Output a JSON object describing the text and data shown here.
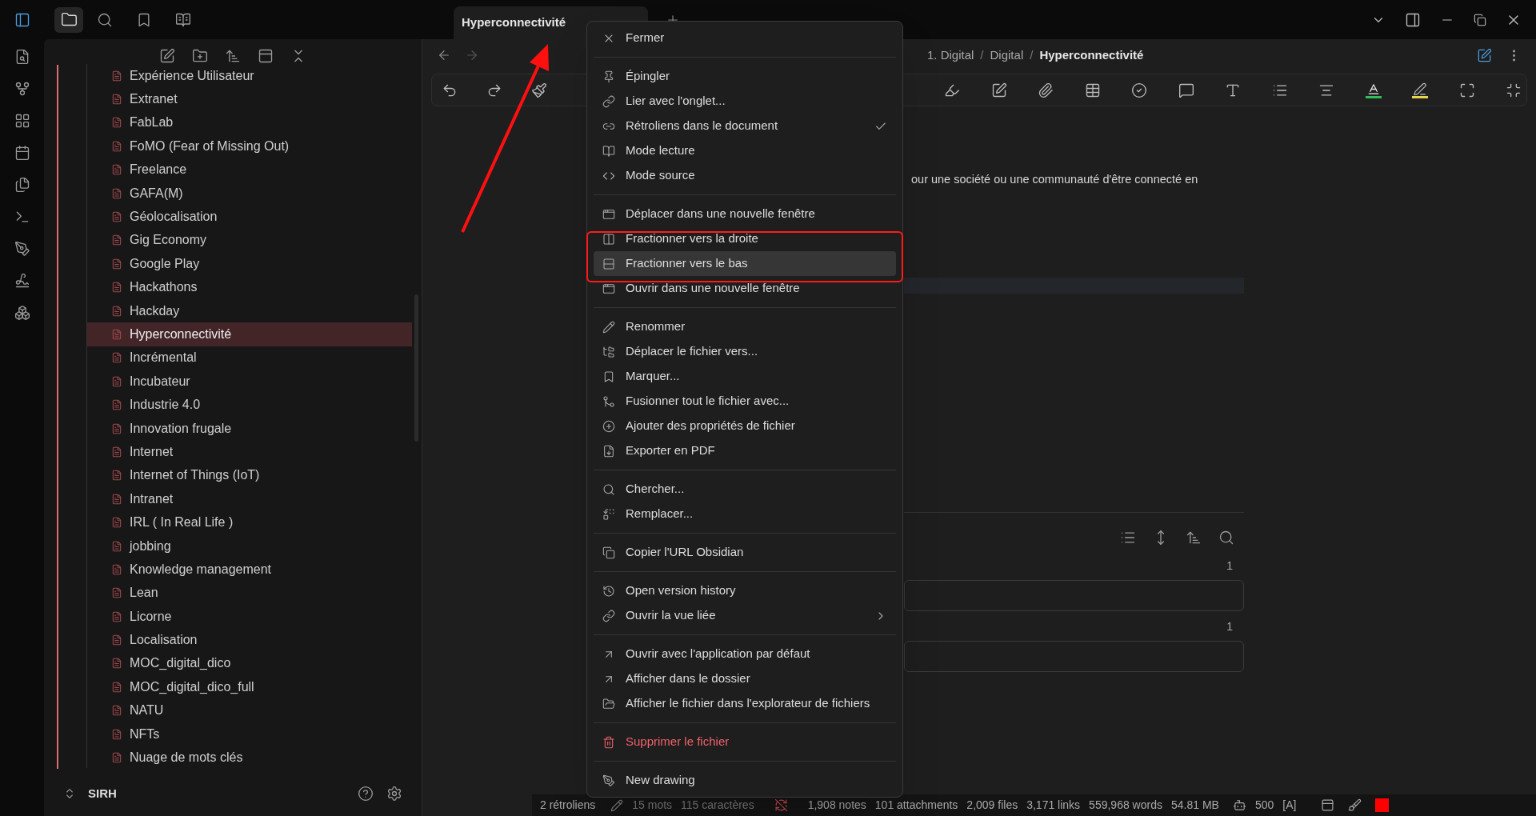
{
  "tab_bar": {
    "tab": {
      "title": "Hyperconnectivité"
    }
  },
  "sidebar": {
    "files": [
      {
        "name": "Expérience Utilisateur",
        "selected": false
      },
      {
        "name": "Extranet",
        "selected": false
      },
      {
        "name": "FabLab",
        "selected": false
      },
      {
        "name": "FoMO (Fear of Missing Out)",
        "selected": false
      },
      {
        "name": "Freelance",
        "selected": false
      },
      {
        "name": "GAFA(M)",
        "selected": false
      },
      {
        "name": "Géolocalisation",
        "selected": false
      },
      {
        "name": "Gig Economy",
        "selected": false
      },
      {
        "name": "Google Play",
        "selected": false
      },
      {
        "name": "Hackathons",
        "selected": false
      },
      {
        "name": "Hackday",
        "selected": false
      },
      {
        "name": "Hyperconnectivité",
        "selected": true
      },
      {
        "name": "Incrémental",
        "selected": false
      },
      {
        "name": "Incubateur",
        "selected": false
      },
      {
        "name": "Industrie 4.0",
        "selected": false
      },
      {
        "name": "Innovation frugale",
        "selected": false
      },
      {
        "name": "Internet",
        "selected": false
      },
      {
        "name": "Internet of Things (IoT)",
        "selected": false
      },
      {
        "name": "Intranet",
        "selected": false
      },
      {
        "name": "IRL ( In Real Life )",
        "selected": false
      },
      {
        "name": "jobbing",
        "selected": false
      },
      {
        "name": "Knowledge management",
        "selected": false
      },
      {
        "name": "Lean",
        "selected": false
      },
      {
        "name": "Licorne",
        "selected": false
      },
      {
        "name": "Localisation",
        "selected": false
      },
      {
        "name": "MOC_digital_dico",
        "selected": false
      },
      {
        "name": "MOC_digital_dico_full",
        "selected": false
      },
      {
        "name": "NATU",
        "selected": false
      },
      {
        "name": "NFTs",
        "selected": false
      },
      {
        "name": "Nuage de mots clés",
        "selected": false
      }
    ],
    "vault": "SIRH"
  },
  "editor": {
    "breadcrumb": [
      {
        "text": "1. Digital",
        "kind": "folder"
      },
      {
        "text": "/",
        "kind": "separator"
      },
      {
        "text": "Digital",
        "kind": "folder"
      },
      {
        "text": "/",
        "kind": "separator"
      },
      {
        "text": "Hyperconnectivité",
        "kind": "current"
      }
    ],
    "paragraph": "our une société ou une communauté d'être connecté en",
    "backlinks": [
      {
        "count": "1"
      },
      {
        "count": "1"
      }
    ]
  },
  "context_menu": {
    "groups": [
      {
        "items": [
          {
            "label": "Fermer",
            "kind": "normal",
            "checked": false,
            "selected": false,
            "submenu": false
          }
        ]
      },
      {
        "items": [
          {
            "label": "Épingler",
            "kind": "normal",
            "checked": false,
            "selected": false,
            "submenu": false
          },
          {
            "label": "Lier avec l'onglet...",
            "kind": "normal",
            "checked": false,
            "selected": false,
            "submenu": false
          },
          {
            "label": "Rétroliens dans le document",
            "kind": "normal",
            "checked": true,
            "selected": false,
            "submenu": false
          },
          {
            "label": "Mode lecture",
            "kind": "normal",
            "checked": false,
            "selected": false,
            "submenu": false
          },
          {
            "label": "Mode source",
            "kind": "normal",
            "checked": false,
            "selected": false,
            "submenu": false
          }
        ]
      },
      {
        "items": [
          {
            "label": "Déplacer dans une nouvelle fenêtre",
            "kind": "normal",
            "checked": false,
            "selected": false,
            "submenu": false
          },
          {
            "label": "Fractionner vers la droite",
            "kind": "normal",
            "checked": false,
            "selected": false,
            "submenu": false
          },
          {
            "label": "Fractionner vers le bas",
            "kind": "normal",
            "checked": false,
            "selected": true,
            "submenu": false
          },
          {
            "label": "Ouvrir dans une nouvelle fenêtre",
            "kind": "normal",
            "checked": false,
            "selected": false,
            "submenu": false
          }
        ]
      },
      {
        "items": [
          {
            "label": "Renommer",
            "kind": "normal",
            "checked": false,
            "selected": false,
            "submenu": false
          },
          {
            "label": "Déplacer le fichier vers...",
            "kind": "normal",
            "checked": false,
            "selected": false,
            "submenu": false
          },
          {
            "label": "Marquer...",
            "kind": "normal",
            "checked": false,
            "selected": false,
            "submenu": false
          },
          {
            "label": "Fusionner tout le fichier avec...",
            "kind": "normal",
            "checked": false,
            "selected": false,
            "submenu": false
          },
          {
            "label": "Ajouter des propriétés de fichier",
            "kind": "normal",
            "checked": false,
            "selected": false,
            "submenu": false
          },
          {
            "label": "Exporter en PDF",
            "kind": "normal",
            "checked": false,
            "selected": false,
            "submenu": false
          }
        ]
      },
      {
        "items": [
          {
            "label": "Chercher...",
            "kind": "normal",
            "checked": false,
            "selected": false,
            "submenu": false
          },
          {
            "label": "Remplacer...",
            "kind": "normal",
            "checked": false,
            "selected": false,
            "submenu": false
          }
        ]
      },
      {
        "items": [
          {
            "label": "Copier l'URL Obsidian",
            "kind": "normal",
            "checked": false,
            "selected": false,
            "submenu": false
          }
        ]
      },
      {
        "items": [
          {
            "label": "Open version history",
            "kind": "normal",
            "checked": false,
            "selected": false,
            "submenu": false
          },
          {
            "label": "Ouvrir la vue liée",
            "kind": "normal",
            "checked": false,
            "selected": false,
            "submenu": true
          }
        ]
      },
      {
        "items": [
          {
            "label": "Ouvrir avec l'application par défaut",
            "kind": "normal",
            "checked": false,
            "selected": false,
            "submenu": false
          },
          {
            "label": "Afficher dans le dossier",
            "kind": "normal",
            "checked": false,
            "selected": false,
            "submenu": false
          },
          {
            "label": "Afficher le fichier dans l'explorateur de fichiers",
            "kind": "normal",
            "checked": false,
            "selected": false,
            "submenu": false
          }
        ]
      },
      {
        "items": [
          {
            "label": "Supprimer le fichier",
            "kind": "danger",
            "checked": false,
            "selected": false,
            "submenu": false
          }
        ]
      },
      {
        "items": [
          {
            "label": "New drawing",
            "kind": "normal",
            "checked": false,
            "selected": false,
            "submenu": false
          }
        ]
      }
    ]
  },
  "status_bar": {
    "items": [
      "2 rétroliens",
      "15 mots",
      "115 caractères",
      "1,908 notes",
      "101 attachments",
      "2,009 files",
      "3,171 links",
      "559,968 words",
      "54.81 MB",
      "500",
      "[A]"
    ]
  }
}
